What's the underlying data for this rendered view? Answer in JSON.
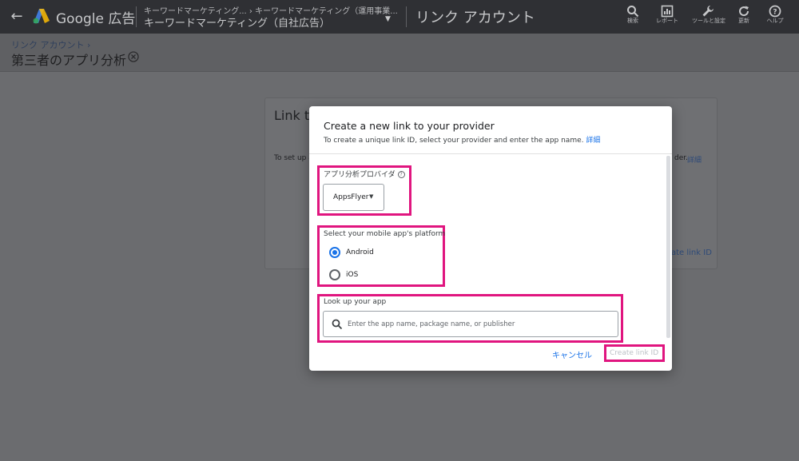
{
  "topbar": {
    "product_name": "Google 広告",
    "breadcrumb_line1": "キーワードマーケティング...  ›  キーワードマーケティング（運用事業...",
    "breadcrumb_line2": "キーワードマーケティング（自社広告）",
    "section_title": "リンク アカウント",
    "tools": [
      {
        "label": "検索",
        "icon": "search-icon"
      },
      {
        "label": "レポート",
        "icon": "report-icon"
      },
      {
        "label": "ツールと設定",
        "icon": "wrench-icon"
      },
      {
        "label": "更新",
        "icon": "refresh-icon"
      },
      {
        "label": "ヘルプ",
        "icon": "help-icon"
      }
    ]
  },
  "subheader": {
    "breadcrumb": "リンク アカウント ›",
    "title": "第三者のアプリ分析"
  },
  "background_card": {
    "title": "Link th",
    "text": "To set up a",
    "text_tail": "der.",
    "link": "詳細",
    "create_link": "ate link ID"
  },
  "dialog": {
    "title": "Create a new link to your provider",
    "description": "To create a unique link ID, select your provider and enter the app name. ",
    "description_link": "詳細",
    "provider_label": "アプリ分析プロバイダ",
    "provider_value": "AppsFlyer",
    "platform_label": "Select your mobile app's platform",
    "platform_options": [
      {
        "label": "Android",
        "selected": true
      },
      {
        "label": "iOS",
        "selected": false
      }
    ],
    "lookup_label": "Look up your app",
    "lookup_placeholder": "Enter the app name, package name, or publisher",
    "cancel_label": "キャンセル",
    "create_label": "Create link ID"
  },
  "colors": {
    "highlight": "#e0157f",
    "accent": "#1a73e8",
    "topbar": "#2f3034"
  }
}
